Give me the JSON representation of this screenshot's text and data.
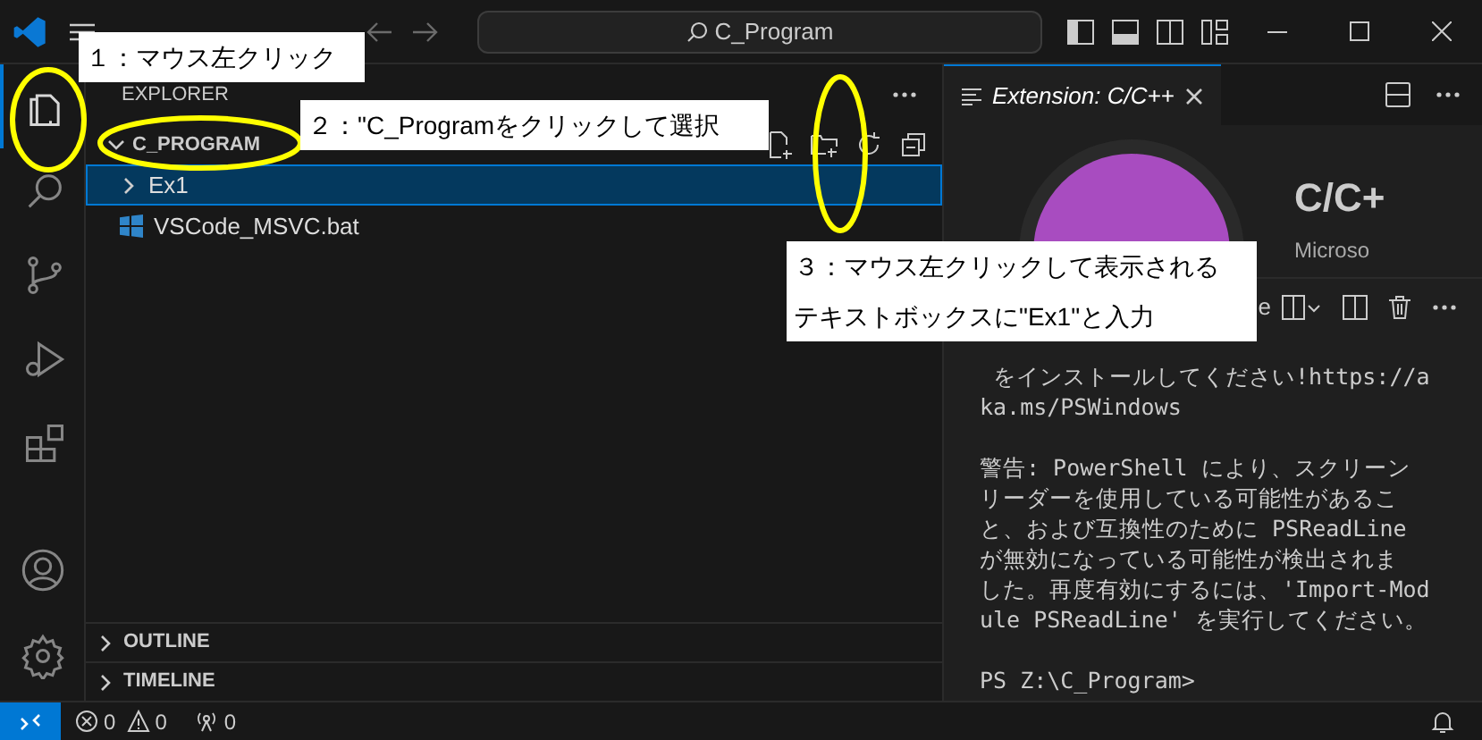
{
  "title_bar": {
    "search": "C_Program"
  },
  "activity_bar": {
    "items": [
      {
        "kind": "explorer",
        "selected": true
      },
      {
        "kind": "search",
        "selected": false
      },
      {
        "kind": "source-control",
        "selected": false
      },
      {
        "kind": "debug",
        "selected": false
      },
      {
        "kind": "extensions",
        "selected": false
      }
    ]
  },
  "sidebar": {
    "title": "EXPLORER",
    "folder": {
      "name": "C_PROGRAM",
      "expanded": true,
      "children": [
        {
          "name": "Ex1",
          "kind": "folder",
          "expanded": false,
          "selected": true
        },
        {
          "name": "VSCode_MSVC.bat",
          "kind": "file",
          "selected": false
        }
      ]
    },
    "sections": [
      {
        "label": "OUTLINE",
        "expanded": false
      },
      {
        "label": "TIMELINE",
        "expanded": false
      }
    ]
  },
  "editor": {
    "tab": {
      "label": "Extension: C/C++"
    },
    "extension": {
      "name": "C/C+",
      "publisher": "Microso"
    }
  },
  "terminal": {
    "label": "e",
    "paragraphs": [
      [
        " をインストールしてください!https://a",
        "ka.ms/PSWindows"
      ],
      [
        "警告: PowerShell により、スクリーン",
        "リーダーを使用している可能性があるこ",
        "と、および互換性のために PSReadLine",
        "が無効になっている可能性が検出されま",
        "した。再度有効にするには、'Import-Mod",
        "ule PSReadLine' を実行してください。"
      ],
      [
        "PS Z:\\C_Program>"
      ]
    ]
  },
  "status_bar": {
    "errors": "0",
    "warnings": "0",
    "ports": "0"
  },
  "annotations": [
    {
      "lines": [
        "１：マウス左クリック"
      ]
    },
    {
      "lines": [
        "２：\"C_Programをクリックして選択"
      ]
    },
    {
      "lines": [
        "３：マウス左クリックして表示される",
        "テキストボックスに\"Ex1\"と入力"
      ]
    }
  ]
}
